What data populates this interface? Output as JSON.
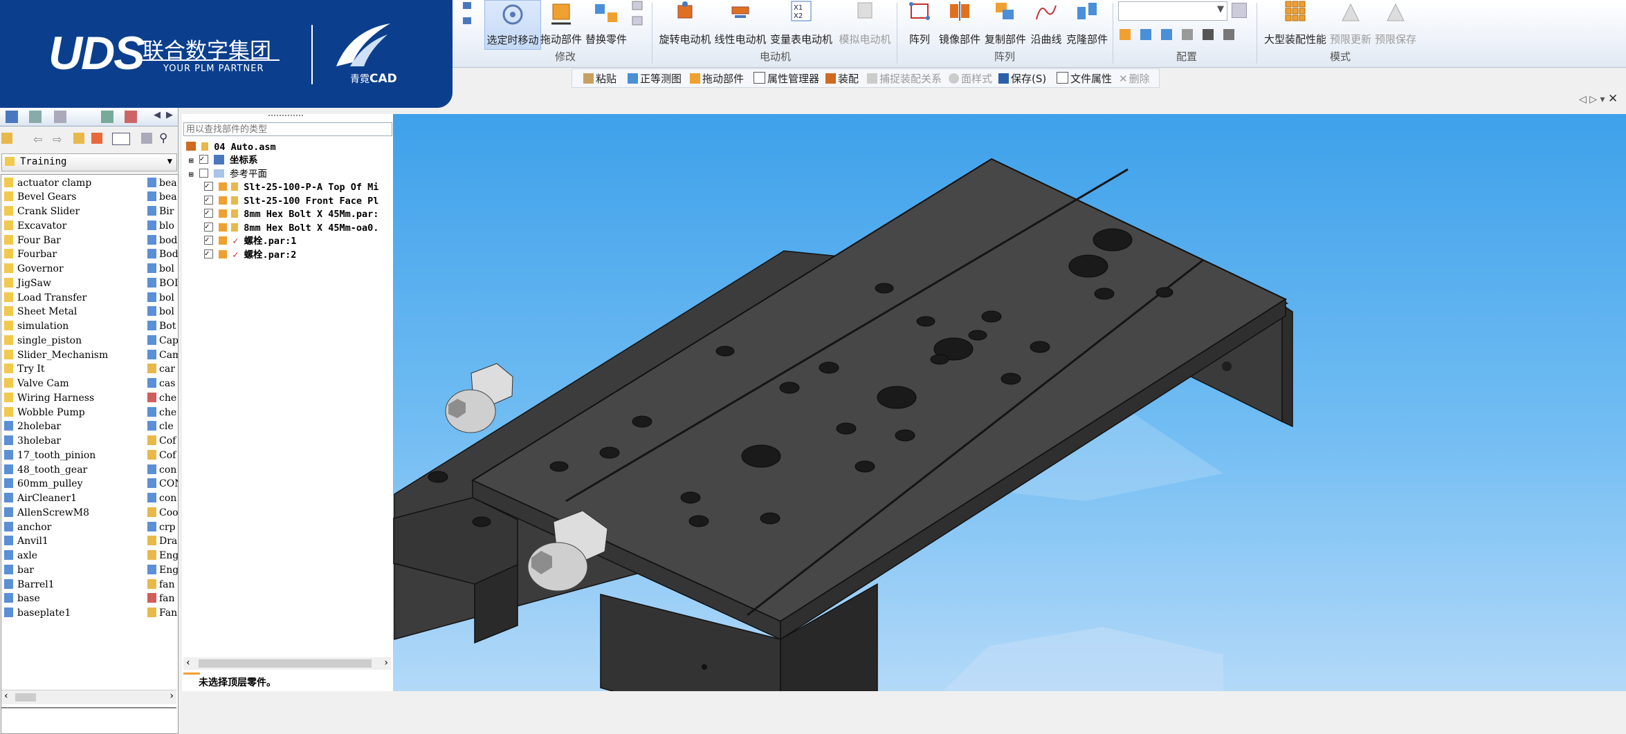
{
  "logo": {
    "brand": "UDS",
    "company": "联合数字集团",
    "tagline": "YOUR PLM PARTNER",
    "product_prefix": "青霓",
    "product": "CAD"
  },
  "ribbon": {
    "buttons": [
      {
        "label": "选定时移动",
        "icon": "move-icon"
      },
      {
        "label": "拖动部件",
        "icon": "drag-part-icon"
      },
      {
        "label": "替换零件",
        "icon": "replace-part-icon"
      },
      {
        "label": "旋转电动机",
        "icon": "rotary-motor-icon"
      },
      {
        "label": "线性电动机",
        "icon": "linear-motor-icon"
      },
      {
        "label": "变量表电动机",
        "icon": "variable-motor-icon"
      },
      {
        "label": "模拟电动机",
        "icon": "simulate-motor-icon"
      },
      {
        "label": "阵列",
        "icon": "pattern-icon"
      },
      {
        "label": "镜像部件",
        "icon": "mirror-icon"
      },
      {
        "label": "复制部件",
        "icon": "copy-part-icon"
      },
      {
        "label": "沿曲线",
        "icon": "along-curve-icon"
      },
      {
        "label": "克隆部件",
        "icon": "clone-icon"
      },
      {
        "label": "大型装配性能",
        "icon": "large-assembly-icon"
      },
      {
        "label": "预限更新",
        "icon": "update-icon"
      },
      {
        "label": "预限保存",
        "icon": "save-limit-icon"
      }
    ],
    "groups": [
      "修改",
      "电动机",
      "阵列",
      "配置",
      "模式"
    ]
  },
  "commands": [
    "粘贴",
    "正等测图",
    "拖动部件",
    "属性管理器",
    "装配",
    "捕捉装配关系",
    "面样式",
    "保存(S)",
    "文件属性",
    "删除"
  ],
  "library": {
    "folder": "Training",
    "items": [
      "actuator clamp",
      "Bevel Gears",
      "Crank Slider",
      "Excavator",
      "Four Bar",
      "Fourbar",
      "Governor",
      "JigSaw",
      "Load Transfer",
      "Sheet Metal",
      "simulation",
      "single_piston",
      "Slider_Mechanism",
      "Try It",
      "Valve Cam",
      "Wiring Harness",
      "Wobble Pump",
      "2holebar",
      "3holebar",
      "17_tooth_pinion",
      "48_tooth_gear",
      "60mm_pulley",
      "AirCleaner1",
      "AllenScrewM8",
      "anchor",
      "Anvil1",
      "axle",
      "bar",
      "Barrel1",
      "base",
      "baseplate1"
    ],
    "col2": [
      "bea",
      "bea",
      "Bir",
      "blo",
      "bod",
      "Bod",
      "bol",
      "BOI",
      "bol",
      "bol",
      "Bot",
      "Cap",
      "Cam",
      "car",
      "cas",
      "che",
      "che",
      "cle",
      "Cof",
      "Cof",
      "con",
      "CON",
      "con",
      "Coo",
      "crp",
      "Dra",
      "Eng",
      "Eng",
      "fan",
      "fan",
      "Fan"
    ]
  },
  "tree": {
    "search_placeholder": "用以查找部件的类型",
    "root": "04 Auto.asm",
    "nodes": [
      "坐标系",
      "参考平面",
      "Slt-25-100-P-A Top Of Mi",
      "Slt-25-100 Front Face Pl",
      "8mm Hex Bolt X 45Mm.par:",
      "8mm Hex Bolt X 45Mm-oa0.",
      "螺栓.par:1",
      "螺栓.par:2"
    ],
    "status": "未选择顶层零件。"
  },
  "colors": {
    "brand_blue": "#0b3f8e",
    "viewport_top": "#3ea1ea",
    "viewport_bottom": "#b3d9f8",
    "part": "#3a3a3a"
  }
}
